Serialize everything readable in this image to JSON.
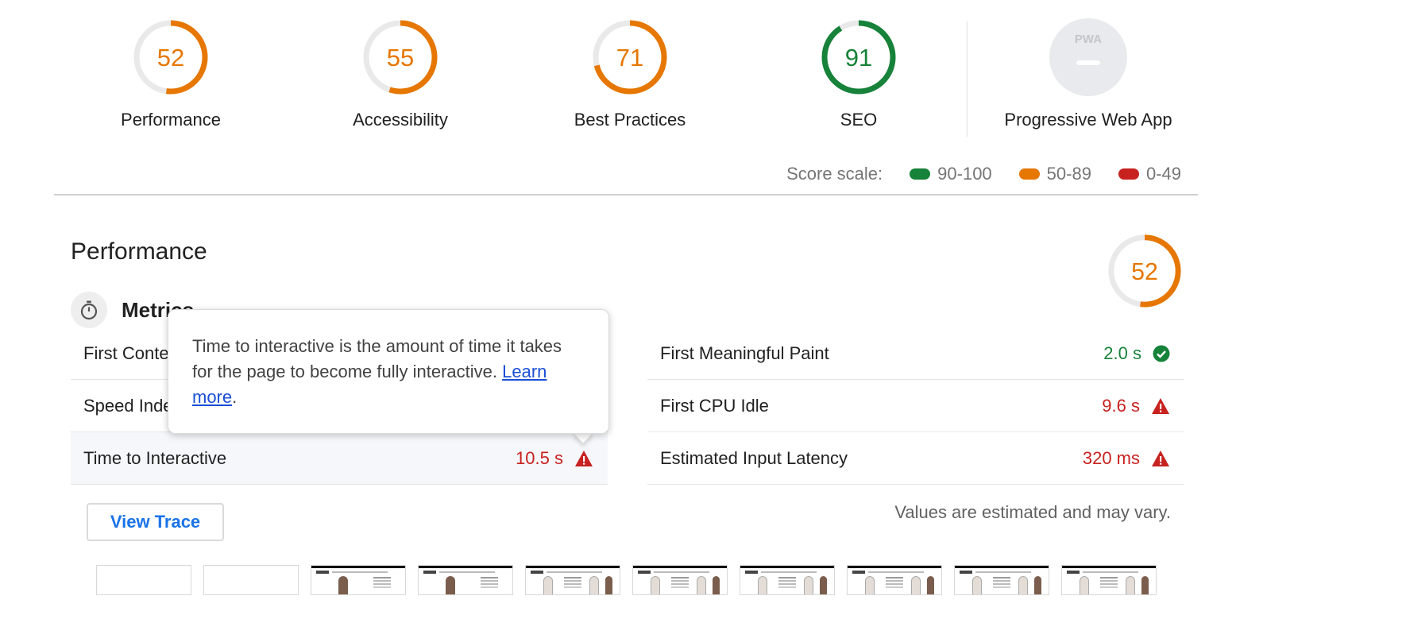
{
  "colors": {
    "pass": "#178239",
    "average": "#e67700",
    "fail": "#c7221f",
    "track": "#e9e9e9",
    "link": "#1a73e8"
  },
  "gauges": [
    {
      "score": 52,
      "label": "Performance",
      "fraction": 0.52,
      "rating": "average"
    },
    {
      "score": 55,
      "label": "Accessibility",
      "fraction": 0.55,
      "rating": "average"
    },
    {
      "score": 71,
      "label": "Best Practices",
      "fraction": 0.71,
      "rating": "average"
    },
    {
      "score": 91,
      "label": "SEO",
      "fraction": 0.91,
      "rating": "pass"
    }
  ],
  "pwa": {
    "badge": "PWA",
    "label": "Progressive Web App"
  },
  "score_scale": {
    "label": "Score scale:",
    "ranges": [
      {
        "text": "90-100",
        "rating": "pass"
      },
      {
        "text": "50-89",
        "rating": "average"
      },
      {
        "text": "0-49",
        "rating": "fail"
      }
    ]
  },
  "performance": {
    "title": "Performance",
    "score": 52,
    "fraction": 0.52,
    "metrics_title": "Metrics",
    "metrics_left": [
      {
        "label": "First Contentful Paint",
        "value": "",
        "status": ""
      },
      {
        "label": "Speed Index",
        "value": "",
        "status": ""
      },
      {
        "label": "Time to Interactive",
        "value": "10.5 s",
        "status": "fail"
      }
    ],
    "metrics_right": [
      {
        "label": "First Meaningful Paint",
        "value": "2.0 s",
        "status": "pass"
      },
      {
        "label": "First CPU Idle",
        "value": "9.6 s",
        "status": "fail"
      },
      {
        "label": "Estimated Input Latency",
        "value": "320 ms",
        "status": "fail"
      }
    ],
    "note": "Values are estimated and may vary.",
    "view_trace": "View Trace"
  },
  "tooltip": {
    "text": "Time to interactive is the amount of time it takes for the page to become fully interactive.",
    "link": "Learn more",
    "suffix": "."
  },
  "filmstrip": [
    {
      "state": "blank"
    },
    {
      "state": "blank"
    },
    {
      "state": "model"
    },
    {
      "state": "model"
    },
    {
      "state": "products"
    },
    {
      "state": "products"
    },
    {
      "state": "products"
    },
    {
      "state": "products"
    },
    {
      "state": "products"
    },
    {
      "state": "products"
    }
  ]
}
